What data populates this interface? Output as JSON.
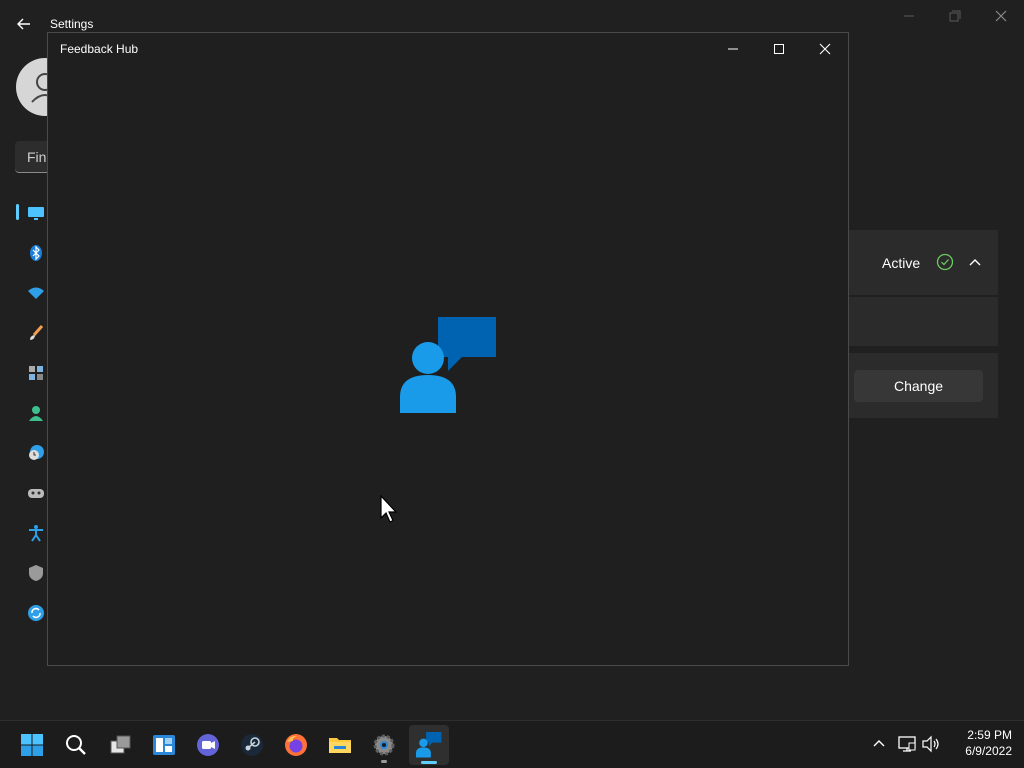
{
  "settings": {
    "title": "Settings",
    "search_placeholder": "Find a setting",
    "search_visible": "Fin",
    "status_label": "Active",
    "change_label": "Change",
    "nav_icons": [
      "display-icon",
      "bluetooth-icon",
      "wifi-icon",
      "brush-icon",
      "apps-icon",
      "account-icon",
      "time-language-icon",
      "gaming-icon",
      "accessibility-icon",
      "shield-icon",
      "update-icon"
    ]
  },
  "feedback_hub": {
    "title": "Feedback Hub"
  },
  "taskbar": {
    "apps": [
      "start",
      "search",
      "task-view",
      "widgets",
      "teams-chat",
      "steam",
      "firefox",
      "file-explorer",
      "settings",
      "feedback-hub"
    ]
  },
  "tray": {
    "time": "2:59 PM",
    "date": "6/9/2022"
  },
  "colors": {
    "accent": "#60cdff",
    "success": "#6ccb5f",
    "window_bg": "#1f1f1f"
  }
}
